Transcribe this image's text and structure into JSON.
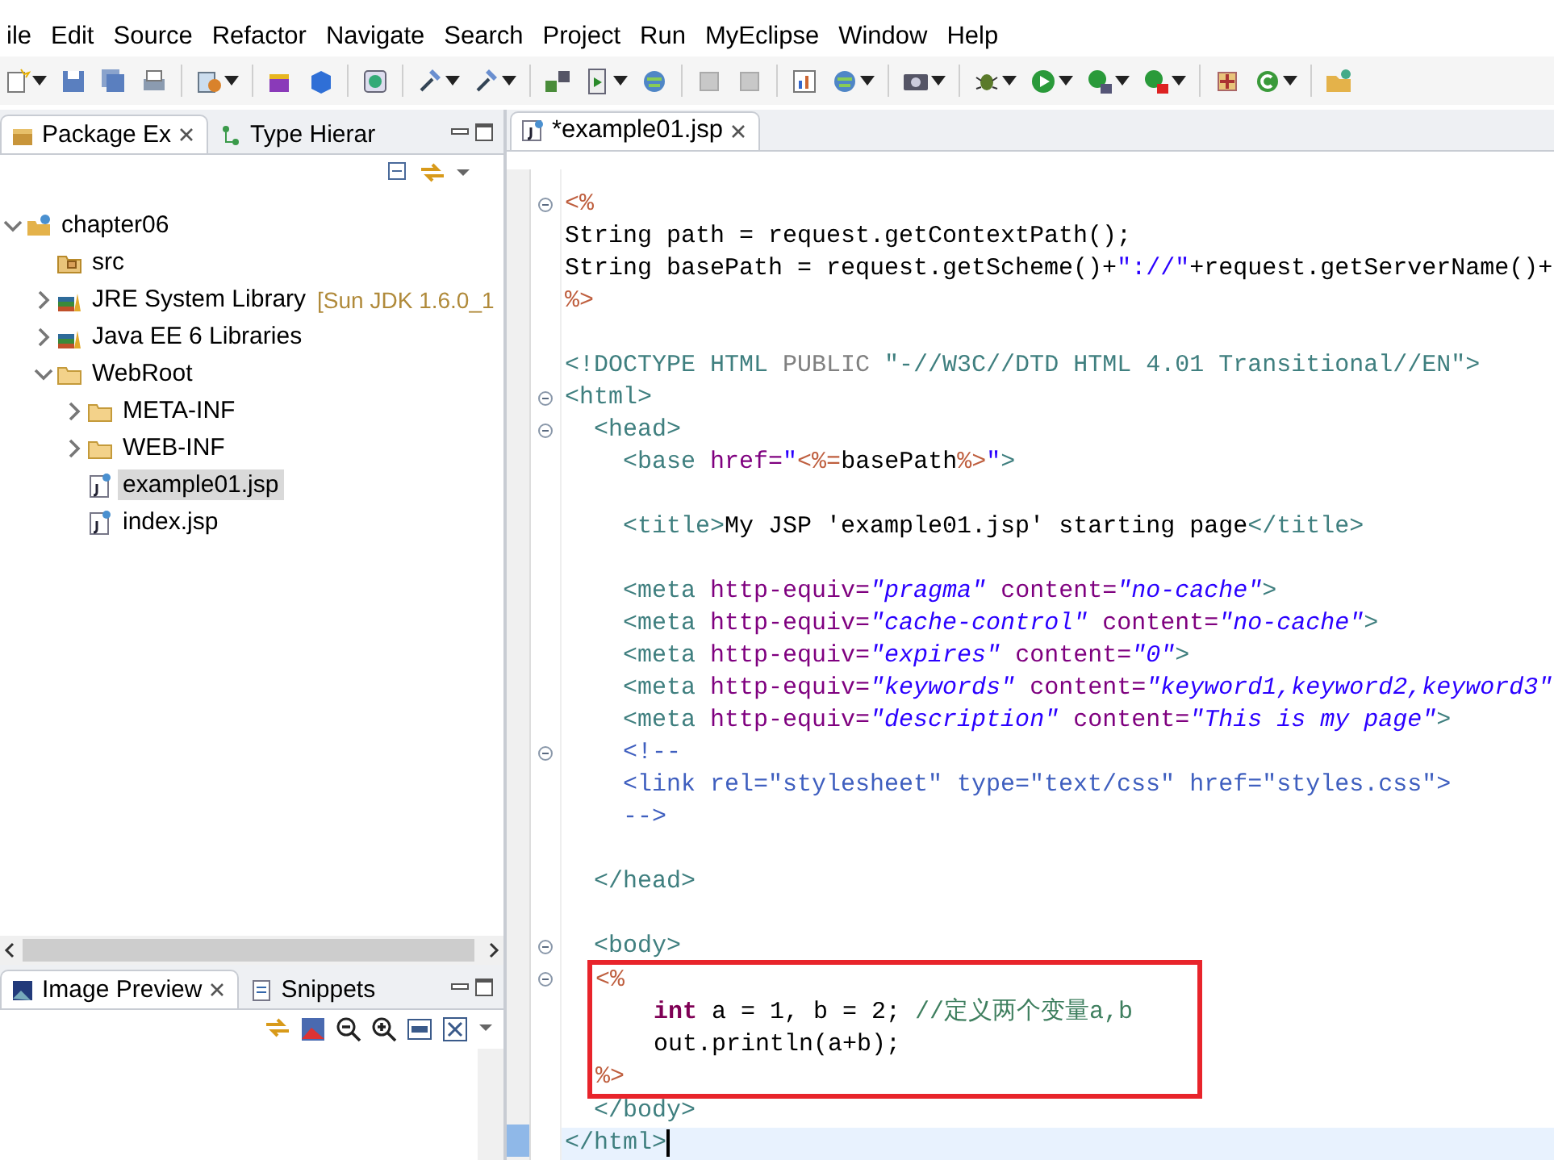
{
  "menu": [
    "ile",
    "Edit",
    "Source",
    "Refactor",
    "Navigate",
    "Search",
    "Project",
    "Run",
    "MyEclipse",
    "Window",
    "Help"
  ],
  "toolbar": [
    {
      "kind": "new",
      "caret": true
    },
    {
      "kind": "save",
      "caret": false
    },
    {
      "kind": "save-all",
      "caret": false
    },
    {
      "kind": "print",
      "caret": false
    },
    {
      "kind": "sep"
    },
    {
      "kind": "wizard",
      "caret": true
    },
    {
      "kind": "sep"
    },
    {
      "kind": "box",
      "caret": false
    },
    {
      "kind": "cube",
      "caret": false
    },
    {
      "kind": "sep"
    },
    {
      "kind": "badge",
      "caret": false
    },
    {
      "kind": "sep"
    },
    {
      "kind": "hammer",
      "caret": true
    },
    {
      "kind": "hammer",
      "caret": true
    },
    {
      "kind": "sep"
    },
    {
      "kind": "deploy",
      "caret": false
    },
    {
      "kind": "server",
      "caret": true
    },
    {
      "kind": "globe",
      "caret": false
    },
    {
      "kind": "sep"
    },
    {
      "kind": "grey",
      "caret": false
    },
    {
      "kind": "grey",
      "caret": false
    },
    {
      "kind": "sep"
    },
    {
      "kind": "chart",
      "caret": false
    },
    {
      "kind": "globe",
      "caret": true
    },
    {
      "kind": "sep"
    },
    {
      "kind": "camera",
      "caret": true
    },
    {
      "kind": "sep"
    },
    {
      "kind": "bug",
      "caret": true
    },
    {
      "kind": "run",
      "caret": true
    },
    {
      "kind": "run-ext",
      "caret": true
    },
    {
      "kind": "run-stop",
      "caret": true
    },
    {
      "kind": "sep"
    },
    {
      "kind": "plus",
      "caret": false
    },
    {
      "kind": "class",
      "caret": true
    },
    {
      "kind": "sep"
    },
    {
      "kind": "open",
      "caret": false
    }
  ],
  "left_panel": {
    "tabs": [
      {
        "label": "Package Ex",
        "selected": true,
        "closable": true
      },
      {
        "label": "Type Hierar",
        "selected": false,
        "closable": false
      }
    ],
    "tree": [
      {
        "label": "chapter06",
        "kind": "project",
        "expandable": true,
        "expanded": true,
        "selected": false,
        "children": [
          {
            "label": "src",
            "kind": "package-folder",
            "expandable": false,
            "selected": false
          },
          {
            "label": "JRE System Library",
            "decoration": "[Sun JDK 1.6.0_1",
            "kind": "library",
            "expandable": true,
            "expanded": false,
            "selected": false
          },
          {
            "label": "Java EE 6 Libraries",
            "kind": "library",
            "expandable": true,
            "expanded": false,
            "selected": false
          },
          {
            "label": "WebRoot",
            "kind": "folder",
            "expandable": true,
            "expanded": true,
            "selected": false,
            "children": [
              {
                "label": "META-INF",
                "kind": "folder",
                "expandable": true,
                "expanded": false,
                "selected": false
              },
              {
                "label": "WEB-INF",
                "kind": "folder",
                "expandable": true,
                "expanded": false,
                "selected": false
              },
              {
                "label": "example01.jsp",
                "kind": "jsp",
                "expandable": false,
                "selected": true
              },
              {
                "label": "index.jsp",
                "kind": "jsp",
                "expandable": false,
                "selected": false
              }
            ]
          }
        ]
      }
    ]
  },
  "bottom_panel": {
    "tabs": [
      {
        "label": "Image Preview",
        "selected": true,
        "closable": true
      },
      {
        "label": "Snippets",
        "selected": false,
        "closable": false
      }
    ]
  },
  "editor": {
    "tab": {
      "label": "*example01.jsp",
      "selected": true
    },
    "lines": [
      {
        "fold": true,
        "boxed": false,
        "current": false,
        "segments": [
          {
            "text": "<%",
            "kind": "jsp"
          }
        ]
      },
      {
        "fold": false,
        "boxed": false,
        "current": false,
        "segments": [
          {
            "text": "String path = request.getContextPath();",
            "kind": "plain"
          }
        ]
      },
      {
        "fold": false,
        "boxed": false,
        "current": false,
        "segments": [
          {
            "text": "String basePath = request.getScheme()+",
            "kind": "plain"
          },
          {
            "text": "\"://\"",
            "kind": "value"
          },
          {
            "text": "+request.getServerName()+",
            "kind": "plain"
          }
        ]
      },
      {
        "fold": false,
        "boxed": false,
        "current": false,
        "segments": [
          {
            "text": "%>",
            "kind": "jsp"
          }
        ]
      },
      {
        "fold": false,
        "boxed": false,
        "current": false
      },
      {
        "fold": false,
        "boxed": false,
        "current": false,
        "segments": [
          {
            "text": "<!DOCTYPE HTML ",
            "kind": "tag"
          },
          {
            "text": "PUBLIC ",
            "kind": "doctype"
          },
          {
            "text": "\"-//W3C//DTD HTML 4.01 Transitional//EN\">",
            "kind": "tag"
          }
        ]
      },
      {
        "fold": true,
        "boxed": false,
        "current": false,
        "segments": [
          {
            "text": "<html>",
            "kind": "tag"
          }
        ]
      },
      {
        "fold": true,
        "boxed": false,
        "current": false,
        "segments": [
          {
            "text": "  <head>",
            "kind": "tag"
          }
        ]
      },
      {
        "fold": false,
        "boxed": false,
        "current": false,
        "segments": [
          {
            "text": "    <base ",
            "kind": "tag"
          },
          {
            "text": "href=",
            "kind": "attr"
          },
          {
            "text": "\"",
            "kind": "value"
          },
          {
            "text": "<%=",
            "kind": "jsp"
          },
          {
            "text": "basePath",
            "kind": "plain"
          },
          {
            "text": "%>",
            "kind": "jsp"
          },
          {
            "text": "\"",
            "kind": "value"
          },
          {
            "text": ">",
            "kind": "tag"
          }
        ]
      },
      {
        "fold": false,
        "boxed": false,
        "current": false
      },
      {
        "fold": false,
        "boxed": false,
        "current": false,
        "segments": [
          {
            "text": "    <title>",
            "kind": "tag"
          },
          {
            "text": "My JSP 'example01.jsp' starting page",
            "kind": "plain"
          },
          {
            "text": "</title>",
            "kind": "tag"
          }
        ]
      },
      {
        "fold": false,
        "boxed": false,
        "current": false
      },
      {
        "fold": false,
        "boxed": false,
        "current": false,
        "segments": [
          {
            "text": "    <meta ",
            "kind": "tag"
          },
          {
            "text": "http-equiv=",
            "kind": "attr"
          },
          {
            "text": "\"pragma\"",
            "kind": "value-italic"
          },
          {
            "text": " content=",
            "kind": "attr"
          },
          {
            "text": "\"no-cache\"",
            "kind": "value-italic"
          },
          {
            "text": ">",
            "kind": "tag"
          }
        ]
      },
      {
        "fold": false,
        "boxed": false,
        "current": false,
        "segments": [
          {
            "text": "    <meta ",
            "kind": "tag"
          },
          {
            "text": "http-equiv=",
            "kind": "attr"
          },
          {
            "text": "\"cache-control\"",
            "kind": "value-italic"
          },
          {
            "text": " content=",
            "kind": "attr"
          },
          {
            "text": "\"no-cache\"",
            "kind": "value-italic"
          },
          {
            "text": ">",
            "kind": "tag"
          }
        ]
      },
      {
        "fold": false,
        "boxed": false,
        "current": false,
        "segments": [
          {
            "text": "    <meta ",
            "kind": "tag"
          },
          {
            "text": "http-equiv=",
            "kind": "attr"
          },
          {
            "text": "\"expires\"",
            "kind": "value-italic"
          },
          {
            "text": " content=",
            "kind": "attr"
          },
          {
            "text": "\"0\"",
            "kind": "value-italic"
          },
          {
            "text": ">",
            "kind": "tag"
          }
        ]
      },
      {
        "fold": false,
        "boxed": false,
        "current": false,
        "segments": [
          {
            "text": "    <meta ",
            "kind": "tag"
          },
          {
            "text": "http-equiv=",
            "kind": "attr"
          },
          {
            "text": "\"keywords\"",
            "kind": "value-italic"
          },
          {
            "text": " content=",
            "kind": "attr"
          },
          {
            "text": "\"keyword1,keyword2,keyword3\"",
            "kind": "value-italic"
          }
        ]
      },
      {
        "fold": false,
        "boxed": false,
        "current": false,
        "segments": [
          {
            "text": "    <meta ",
            "kind": "tag"
          },
          {
            "text": "http-equiv=",
            "kind": "attr"
          },
          {
            "text": "\"description\"",
            "kind": "value-italic"
          },
          {
            "text": " content=",
            "kind": "attr"
          },
          {
            "text": "\"This is my page\"",
            "kind": "value-italic"
          },
          {
            "text": ">",
            "kind": "tag"
          }
        ]
      },
      {
        "fold": true,
        "boxed": false,
        "current": false,
        "segments": [
          {
            "text": "    <!--",
            "kind": "html-comment"
          }
        ]
      },
      {
        "fold": false,
        "boxed": false,
        "current": false,
        "segments": [
          {
            "text": "    <link rel=\"stylesheet\" type=\"text/css\" href=\"styles.css\">",
            "kind": "html-comment"
          }
        ]
      },
      {
        "fold": false,
        "boxed": false,
        "current": false,
        "segments": [
          {
            "text": "    -->",
            "kind": "html-comment"
          }
        ]
      },
      {
        "fold": false,
        "boxed": false,
        "current": false
      },
      {
        "fold": false,
        "boxed": false,
        "current": false,
        "segments": [
          {
            "text": "  </head>",
            "kind": "tag"
          }
        ]
      },
      {
        "fold": false,
        "boxed": false,
        "current": false
      },
      {
        "fold": true,
        "boxed": false,
        "current": false,
        "segments": [
          {
            "text": "  <body>",
            "kind": "tag"
          }
        ]
      },
      {
        "fold": true,
        "boxed": true,
        "current": false,
        "segments": [
          {
            "text": "  <%",
            "kind": "jsp"
          }
        ]
      },
      {
        "fold": false,
        "boxed": true,
        "current": false,
        "segments": [
          {
            "text": "      int",
            "kind": "keyword"
          },
          {
            "text": " a = 1, b = 2; ",
            "kind": "plain"
          },
          {
            "text": "//定义两个变量a,b",
            "kind": "comment"
          }
        ]
      },
      {
        "fold": false,
        "boxed": true,
        "current": false,
        "segments": [
          {
            "text": "      out.println(a+b);",
            "kind": "plain"
          }
        ]
      },
      {
        "fold": false,
        "boxed": true,
        "current": false,
        "segments": [
          {
            "text": "  %>",
            "kind": "jsp"
          }
        ]
      },
      {
        "fold": false,
        "boxed": false,
        "current": false,
        "segments": [
          {
            "text": "  </body>",
            "kind": "tag"
          }
        ]
      },
      {
        "fold": false,
        "boxed": false,
        "current": true,
        "segments": [
          {
            "text": "</html>",
            "kind": "tag"
          }
        ]
      }
    ]
  }
}
